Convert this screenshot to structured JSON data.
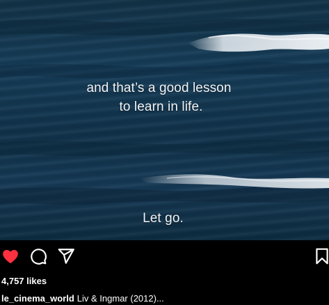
{
  "media": {
    "subtitle_line_1": "and that’s a good lesson",
    "subtitle_line_2": "to learn in life.",
    "subtitle_line_3": "Let go."
  },
  "actions": {
    "like_icon": "heart-filled-icon",
    "comment_icon": "comment-bubble-icon",
    "share_icon": "paper-plane-icon",
    "save_icon": "bookmark-icon",
    "like_color": "#ff3040"
  },
  "post": {
    "likes": "4,757 likes",
    "username": "le_cinema_world",
    "caption": "Liv & Ingmar (2012)..."
  }
}
